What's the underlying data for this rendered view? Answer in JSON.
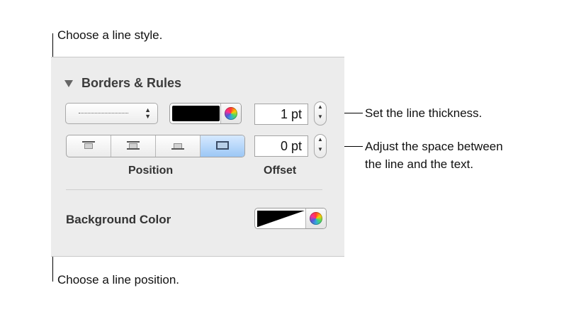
{
  "callouts": {
    "line_style": "Choose a line style.",
    "thickness": "Set the line thickness.",
    "space_line1": "Adjust the space between",
    "space_line2": "the line and the text.",
    "position": "Choose a line position."
  },
  "inspector": {
    "section_title": "Borders & Rules",
    "line_style_popup": {
      "value": "dotted",
      "icon": "up-down-arrows-icon"
    },
    "line_color": {
      "color": "#000000",
      "picker_icon": "color-wheel-icon"
    },
    "thickness": {
      "value": "1 pt"
    },
    "position": {
      "label": "Position",
      "segments": [
        "top",
        "top-and-bottom",
        "bottom",
        "box"
      ],
      "selected": "box"
    },
    "offset": {
      "label": "Offset",
      "value": "0 pt"
    },
    "background": {
      "label": "Background Color",
      "value": "none"
    }
  },
  "colors": {
    "selected_segment": "#9cc7f5",
    "panel_bg": "#ececec"
  }
}
